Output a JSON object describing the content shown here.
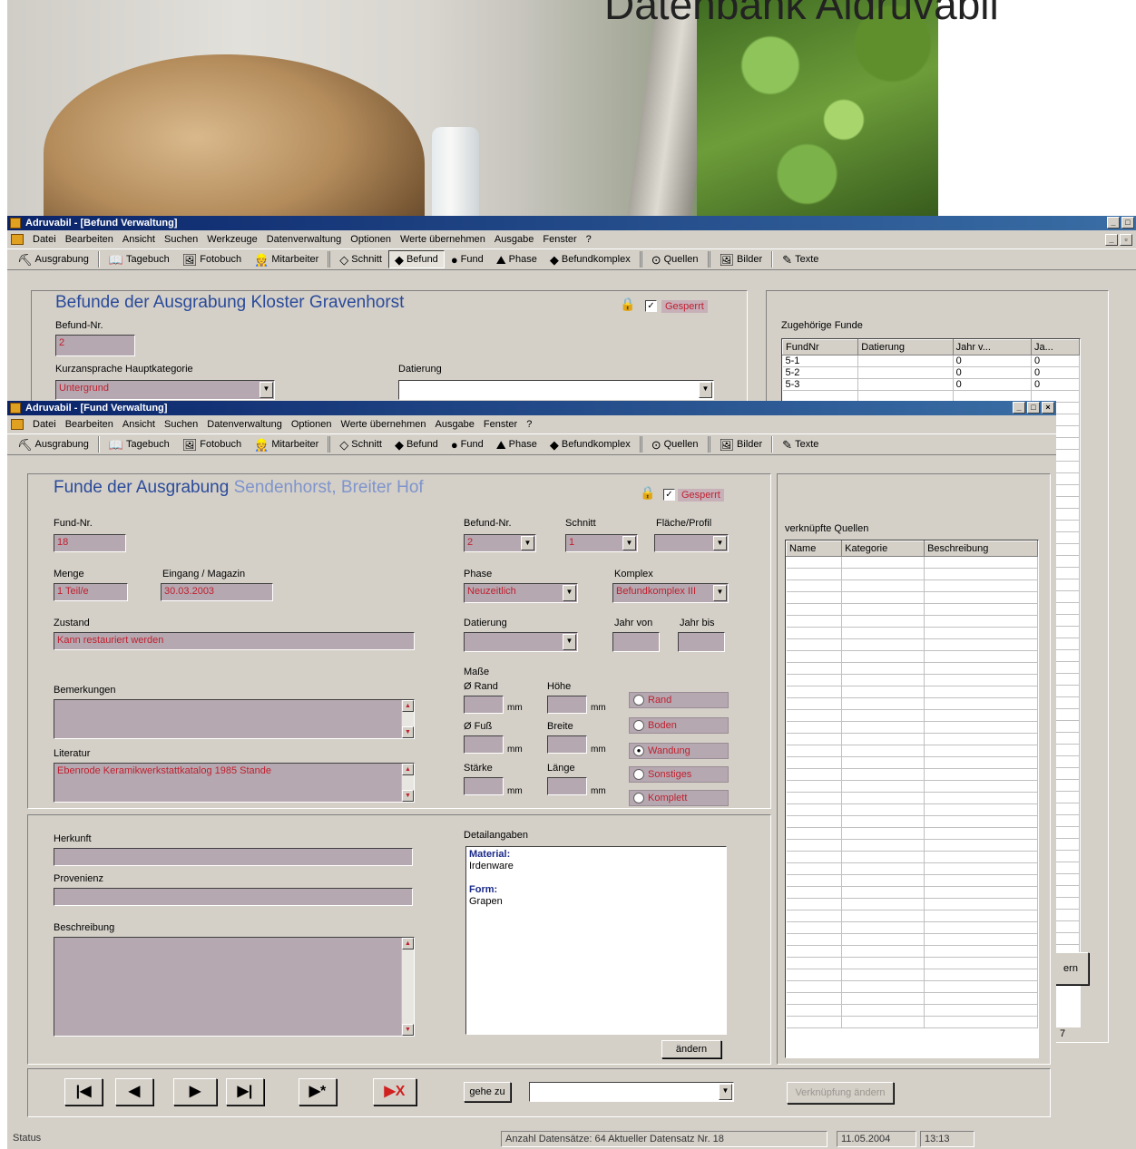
{
  "photo": {
    "title": "Datenbank Aldruvabil"
  },
  "back_window": {
    "title": "Adruvabil - [Befund Verwaltung]",
    "menu": [
      "Datei",
      "Bearbeiten",
      "Ansicht",
      "Suchen",
      "Werkzeuge",
      "Datenverwaltung",
      "Optionen",
      "Werte übernehmen",
      "Ausgabe",
      "Fenster",
      "?"
    ],
    "toolbar": [
      "Ausgrabung",
      "Tagebuch",
      "Fotobuch",
      "Mitarbeiter",
      "Schnitt",
      "Befund",
      "Fund",
      "Phase",
      "Befundkomplex",
      "Quellen",
      "Bilder",
      "Texte"
    ],
    "heading": "Befunde der Ausgrabung Kloster Gravenhorst",
    "locked_label": "Gesperrt",
    "befund_nr_label": "Befund-Nr.",
    "befund_nr_value": "2",
    "kurzansprache_label": "Kurzansprache Hauptkategorie",
    "kurzansprache_value": "Untergrund",
    "datierung_label": "Datierung",
    "funde_label": "Zugehörige Funde",
    "funde_columns": [
      "FundNr",
      "Datierung",
      "Jahr v...",
      "Ja..."
    ],
    "funde_rows": [
      [
        "5-1",
        "",
        "0",
        "0"
      ],
      [
        "5-2",
        "",
        "0",
        "0"
      ],
      [
        "5-3",
        "",
        "0",
        "0"
      ]
    ],
    "side_button": "ern",
    "status_fragment": "7"
  },
  "front_window": {
    "title": "Adruvabil - [Fund Verwaltung]",
    "menu": [
      "Datei",
      "Bearbeiten",
      "Ansicht",
      "Suchen",
      "Datenverwaltung",
      "Optionen",
      "Werte übernehmen",
      "Ausgabe",
      "Fenster",
      "?"
    ],
    "toolbar": [
      "Ausgrabung",
      "Tagebuch",
      "Fotobuch",
      "Mitarbeiter",
      "Schnitt",
      "Befund",
      "Fund",
      "Phase",
      "Befundkomplex",
      "Quellen",
      "Bilder",
      "Texte"
    ],
    "heading_prefix": "Funde der Ausgrabung",
    "heading_place": "Sendenhorst, Breiter Hof",
    "locked_label": "Gesperrt",
    "fund_nr_label": "Fund-Nr.",
    "fund_nr_value": "18",
    "menge_label": "Menge",
    "menge_value": "1 Teil/e",
    "eingang_label": "Eingang / Magazin",
    "eingang_value": "30.03.2003",
    "zustand_label": "Zustand",
    "zustand_value": "Kann restauriert werden",
    "bemerkungen_label": "Bemerkungen",
    "literatur_label": "Literatur",
    "literatur_value": "Ebenrode Keramikwerkstattkatalog 1985 Stande",
    "befund_nr_label": "Befund-Nr.",
    "befund_nr_value": "2",
    "schnitt_label": "Schnitt",
    "schnitt_value": "1",
    "flaeche_label": "Fläche/Profil",
    "phase_label": "Phase",
    "phase_value": "Neuzeitlich",
    "komplex_label": "Komplex",
    "komplex_value": "Befundkomplex III",
    "datierung_label": "Datierung",
    "jahr_von_label": "Jahr von",
    "jahr_bis_label": "Jahr bis",
    "masse_label": "Maße",
    "rand_label": "Ø Rand",
    "hoehe_label": "Höhe",
    "fuss_label": "Ø Fuß",
    "breite_label": "Breite",
    "staerke_label": "Stärke",
    "laenge_label": "Länge",
    "unit": "mm",
    "radios": [
      "Rand",
      "Boden",
      "Wandung",
      "Sonstiges",
      "Komplett"
    ],
    "herkunft_label": "Herkunft",
    "provenienz_label": "Provenienz",
    "beschreibung_label": "Beschreibung",
    "details_label": "Detailangaben",
    "details_material_label": "Material:",
    "details_material_value": "Irdenware",
    "details_form_label": "Form:",
    "details_form_value": "Grapen",
    "aendern_button": "ändern",
    "quellen_label": "verknüpfte Quellen",
    "quellen_columns": [
      "Name",
      "Kategorie",
      "Beschreibung"
    ],
    "goto_button": "gehe zu",
    "verknuepfen_button": "Verknüpfung ändern",
    "status": {
      "left": "Status",
      "records": "Anzahl Datensätze: 64   Aktueller Datensatz Nr. 18",
      "date": "11.05.2004",
      "time": "13:13"
    }
  },
  "colors": {
    "field_bg": "#b6a8b0",
    "field_text": "#c02030",
    "title_blue": "#2a4a9a",
    "titlebar": "#0a246a"
  }
}
